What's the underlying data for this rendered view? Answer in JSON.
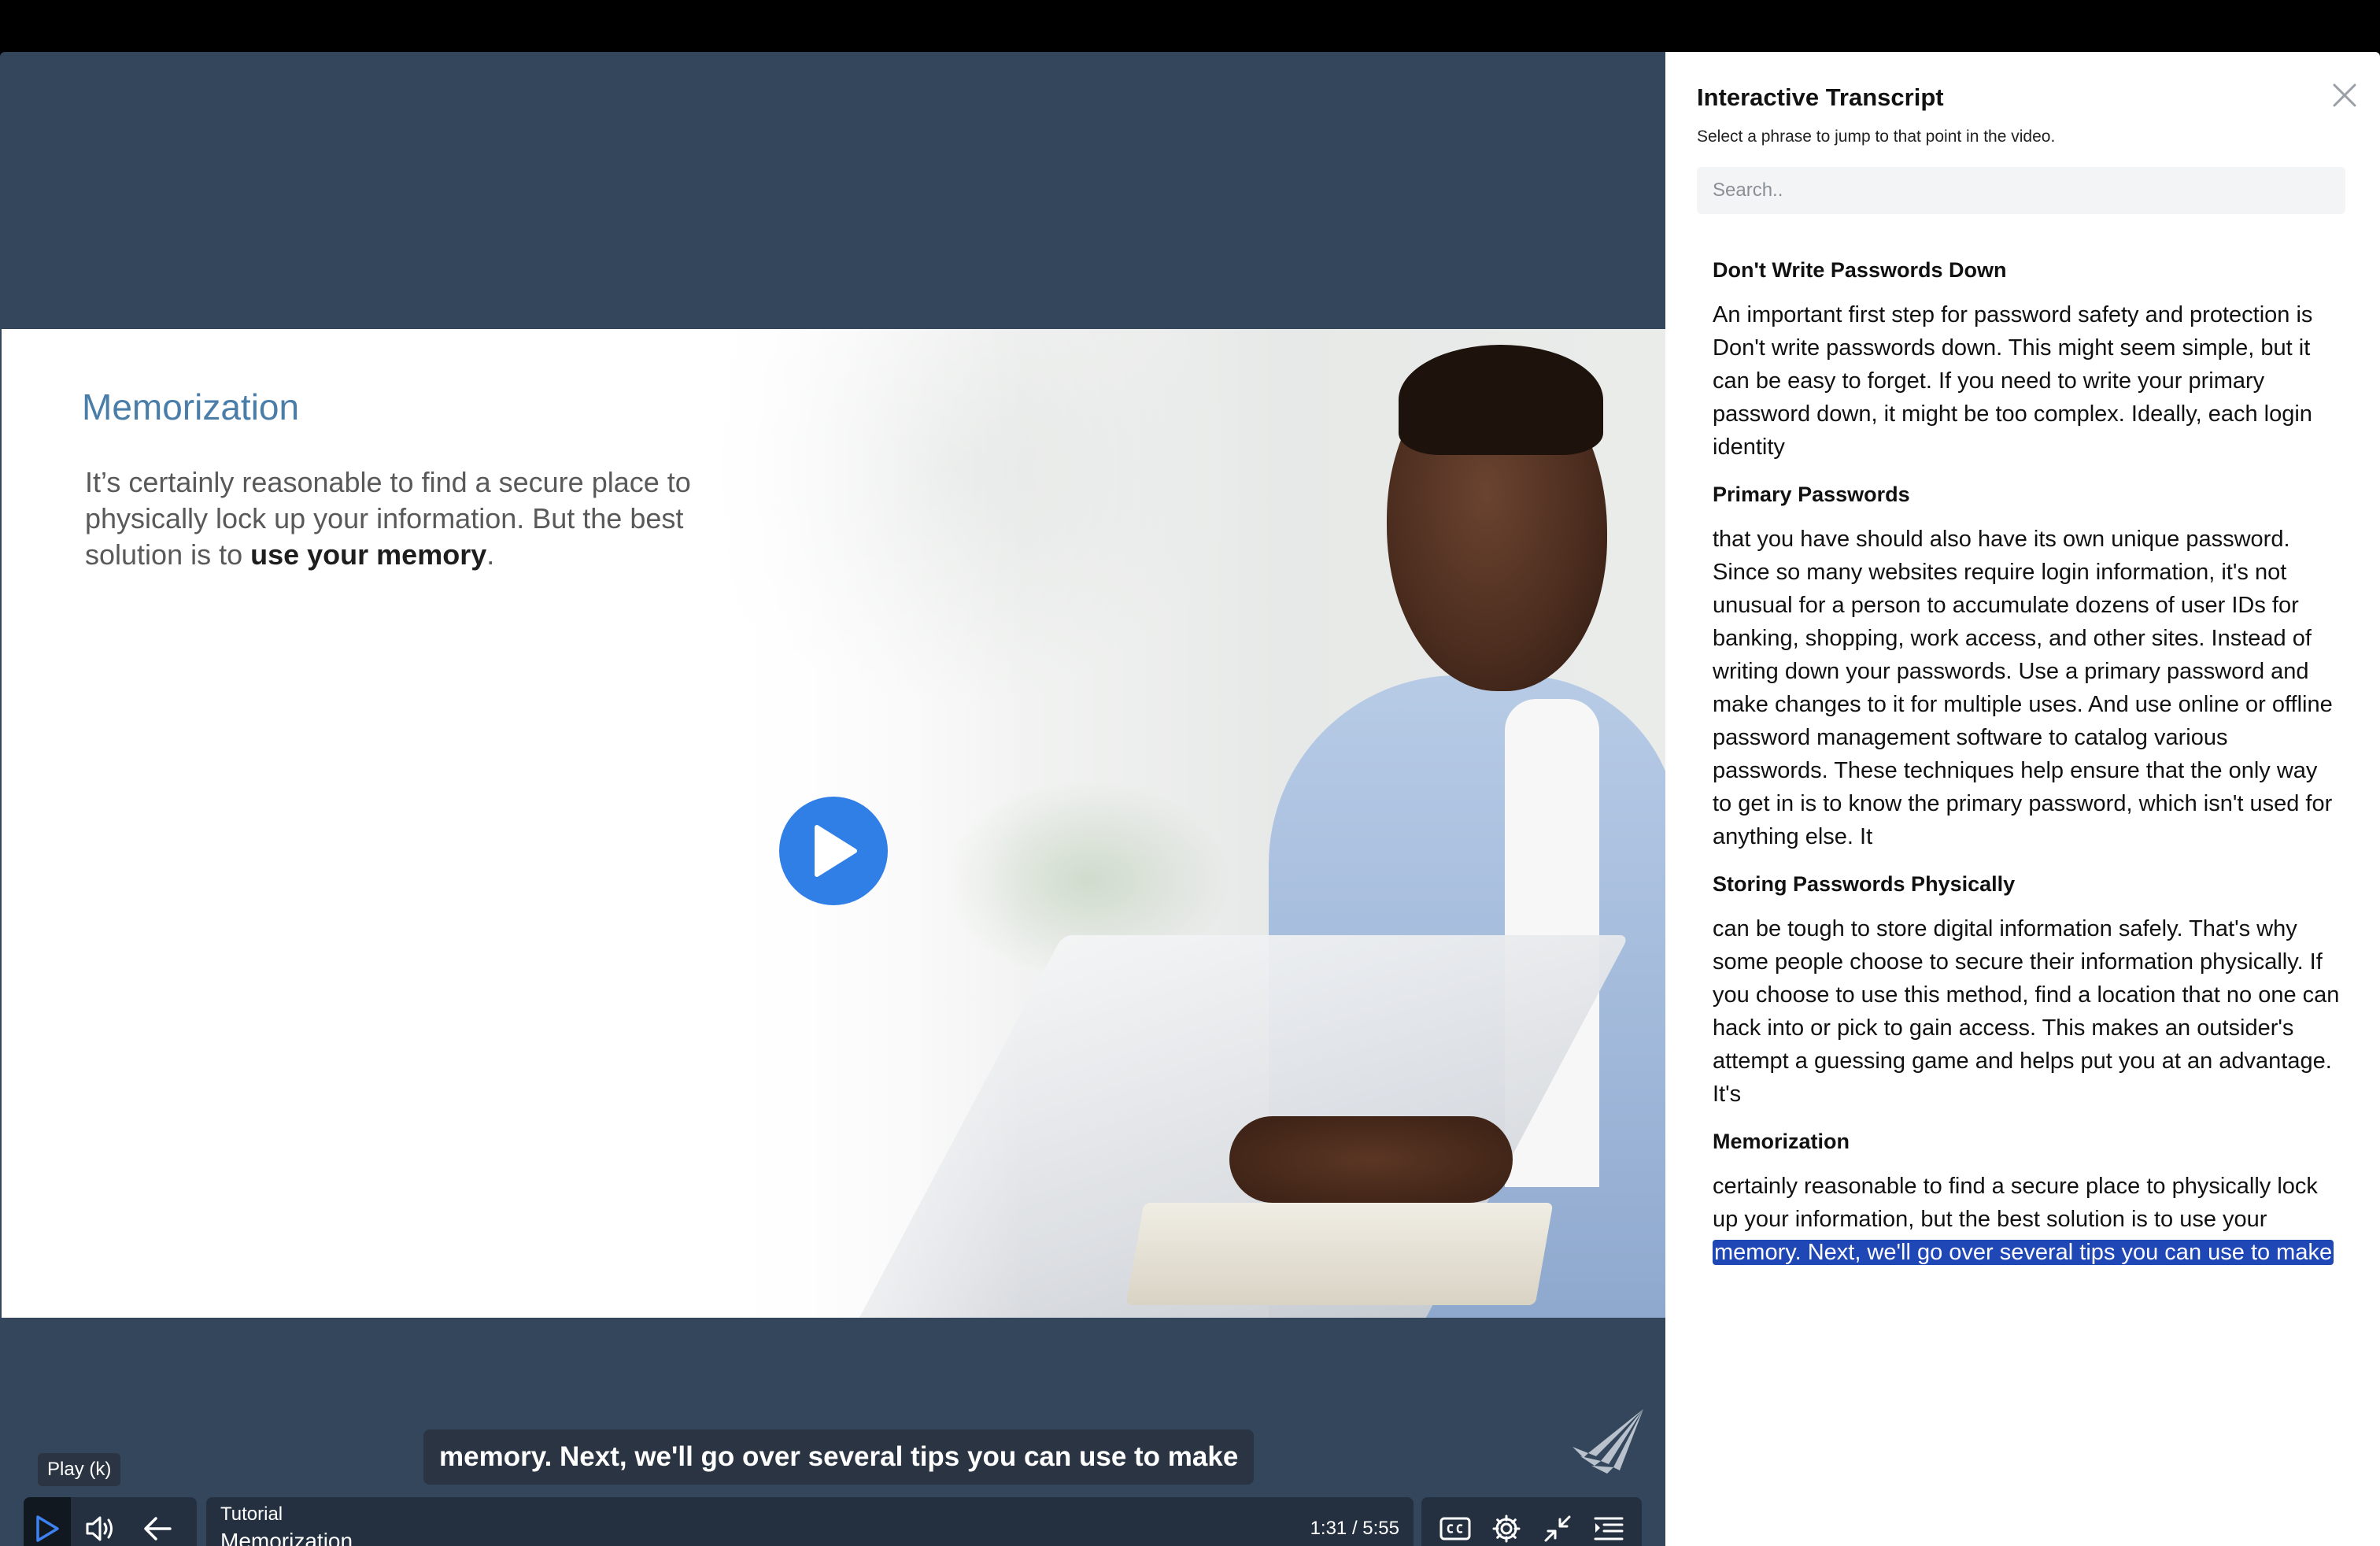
{
  "video": {
    "slide_title": "Memorization",
    "slide_body_prefix": "It’s certainly reasonable to find a secure place to physically lock up your information. But the best solution is to ",
    "slide_body_bold": "use your memory",
    "slide_body_suffix": ".",
    "caption": "memory. Next, we'll go over several tips you can use to make",
    "tooltip": "Play (k)"
  },
  "controls": {
    "label": "Tutorial",
    "title": "Memorization",
    "time": "1:31 / 5:55",
    "icons": {
      "play": "play-icon",
      "volume": "volume-icon",
      "back": "arrow-left-icon",
      "cc": "closed-captions-icon",
      "settings": "gear-icon",
      "minimize": "minimize-icon",
      "transcript": "transcript-icon"
    },
    "accent": "#3d82f0"
  },
  "panel": {
    "title": "Interactive Transcript",
    "subtitle": "Select a phrase to jump to that point in the video.",
    "search_placeholder": "Search..",
    "sections": [
      {
        "heading": "Don't Write Passwords Down",
        "text": "An important first step for password safety and protection is Don't write passwords down. This might seem simple, but it can be easy to forget. If you need to write your primary password down, it might be too complex. Ideally, each login identity"
      },
      {
        "heading": "Primary Passwords",
        "text": "that you have should also have its own unique password. Since so many websites require login information, it's not unusual for a person to accumulate dozens of user IDs for banking, shopping, work access, and other sites. Instead of writing down your passwords. Use a primary password and make changes to it for multiple uses. And use online or offline password management software to catalog various passwords. These techniques help ensure that the only way to get in is to know the primary password, which isn't used for anything else. It"
      },
      {
        "heading": "Storing Passwords Physically",
        "text": "can be tough to store digital information safely. That's why some people choose to secure their information physically. If you choose to use this method, find a location that no one can hack into or pick to gain access. This makes an outsider's attempt a guessing game and helps put you at an advantage. It's"
      },
      {
        "heading": "Memorization",
        "text": "certainly reasonable to find a secure place to physically lock up your information, but the best solution is to use your",
        "highlight": "memory. Next, we'll go over several tips you can use to make"
      }
    ],
    "highlight_color": "#1f48b6"
  }
}
